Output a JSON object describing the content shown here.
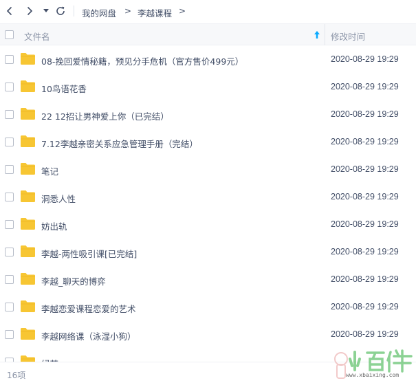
{
  "toolbar": {
    "breadcrumb": [
      "我的网盘",
      "李越课程"
    ],
    "separator": ">"
  },
  "header": {
    "name_label": "文件名",
    "time_label": "修改时间"
  },
  "rows": [
    {
      "name": "08-挽回爱情秘籍，预见分手危机（官方售价499元）",
      "time": "2020-08-29 19:29"
    },
    {
      "name": "10鸟语花香",
      "time": "2020-08-29 19:29"
    },
    {
      "name": "22 12招让男神爱上你（已完结）",
      "time": "2020-08-29 19:29"
    },
    {
      "name": "7.12李越亲密关系应急管理手册（完结）",
      "time": "2020-08-29 19:29"
    },
    {
      "name": "笔记",
      "time": "2020-08-29 19:29"
    },
    {
      "name": "洞悉人性",
      "time": "2020-08-29 19:29"
    },
    {
      "name": "妨出轨",
      "time": "2020-08-29 19:29"
    },
    {
      "name": "李越-两性吸引课[已完结]",
      "time": "2020-08-29 19:29"
    },
    {
      "name": "李越_聊天的博弈",
      "time": "2020-08-29 19:29"
    },
    {
      "name": "李越恋爱课程恋爱的艺术",
      "time": "2020-08-29 19:29"
    },
    {
      "name": "李越网络课（泳湿小狗）",
      "time": "2020-08-29 19:29"
    },
    {
      "name": "绿茶",
      "time": ""
    }
  ],
  "footer": {
    "count": "16项"
  },
  "watermark": {
    "text": "小百件",
    "url": "www.xbaixing.com"
  },
  "colors": {
    "folder": "#f7c633",
    "accent": "#09aaff",
    "text": "#424e67",
    "muted": "#8a93a6"
  }
}
